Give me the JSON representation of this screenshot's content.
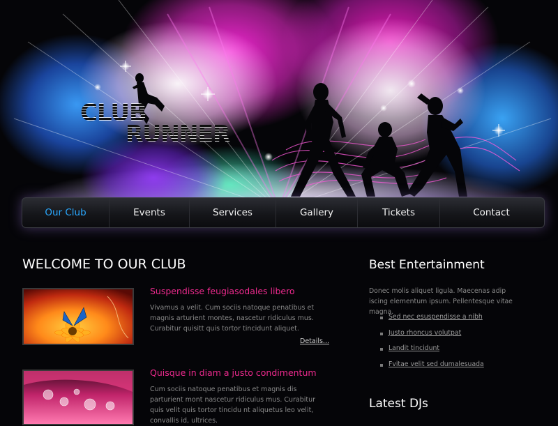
{
  "header": {
    "logo_line1": "CLUB",
    "logo_line2": "RUNNER"
  },
  "nav": {
    "items": [
      {
        "label": "Our Club",
        "active": true
      },
      {
        "label": "Events",
        "active": false
      },
      {
        "label": "Services",
        "active": false
      },
      {
        "label": "Gallery",
        "active": false
      },
      {
        "label": "Tickets",
        "active": false
      },
      {
        "label": "Contact",
        "active": false
      }
    ],
    "active_color": "#29a8ff"
  },
  "main": {
    "title": "WELCOME TO OUR CLUB",
    "posts": [
      {
        "title": "Suspendisse feugiasodales libero",
        "body": "Vivamus a velit. Cum sociis natoque penatibus et magnis arturient montes, nascetur ridiculus mus. Curabitur quisitt quis tortor tincidunt aliquet.",
        "link": "Details...",
        "image": "butterfly-on-flower-image"
      },
      {
        "title": "Quisque in diam a justo condimentum",
        "body": "Cum sociis natoque penatibus et magnis dis parturient mont nascetur ridiculus mus. Curabitur quis velit quis tortor tincidu nt aliquetus leo velit, convallis id, ultrices.",
        "image": "water-drops-on-petal-image"
      }
    ],
    "title_color": "#ee2a8e"
  },
  "sidebar": {
    "entertainment_title": "Best Entertainment",
    "entertainment_text": "Donec molis aliquet ligula. Maecenas adip iscing elementum ipsum. Pellentesque vitae magna.",
    "links": [
      "Sed nec esuspendisse a nibh",
      "Justo rhoncus volutpat",
      "Landit tincidunt",
      "Fvitae velit sed dumalesuada"
    ],
    "djs_title": "Latest DJs"
  }
}
